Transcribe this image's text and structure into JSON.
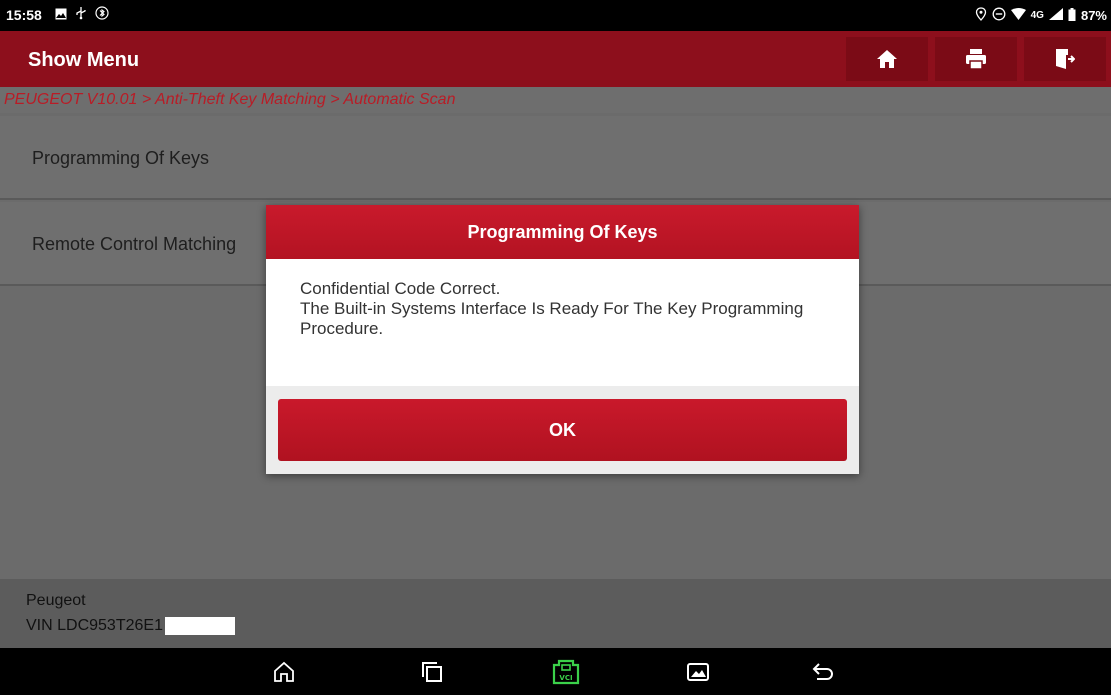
{
  "status_bar": {
    "time": "15:58",
    "left_icons": [
      "image-icon",
      "usb-icon",
      "bluetooth-icon"
    ],
    "network": "4G",
    "battery": "87%",
    "right_icons": [
      "location-icon",
      "do-not-disturb-icon",
      "wifi-icon",
      "signal-icon",
      "battery-icon"
    ]
  },
  "header": {
    "title": "Show Menu",
    "buttons": [
      "home-icon",
      "print-icon",
      "exit-icon"
    ]
  },
  "breadcrumb": "PEUGEOT V10.01 > Anti-Theft Key Matching > Automatic Scan",
  "menu": {
    "items": [
      {
        "label": "Programming Of Keys"
      },
      {
        "label": "Remote Control Matching"
      }
    ]
  },
  "dialog": {
    "title": "Programming Of Keys",
    "lines": [
      "Confidential Code Correct.",
      "The Built-in Systems Interface Is Ready For The Key Programming Procedure."
    ],
    "ok_label": "OK"
  },
  "vehicle": {
    "model": "Peugeot",
    "vin": "VIN LDC953T26E1"
  },
  "nav_bar": {
    "buttons": [
      "home-icon",
      "recents-icon",
      "vci-icon",
      "gallery-icon",
      "back-icon"
    ],
    "vci_label": "VCI",
    "vci_color": "#3bd14a"
  },
  "colors": {
    "header": "#8d0f1c",
    "accent_red": "#c01a2a",
    "breadcrumb_text": "#b91c26"
  }
}
